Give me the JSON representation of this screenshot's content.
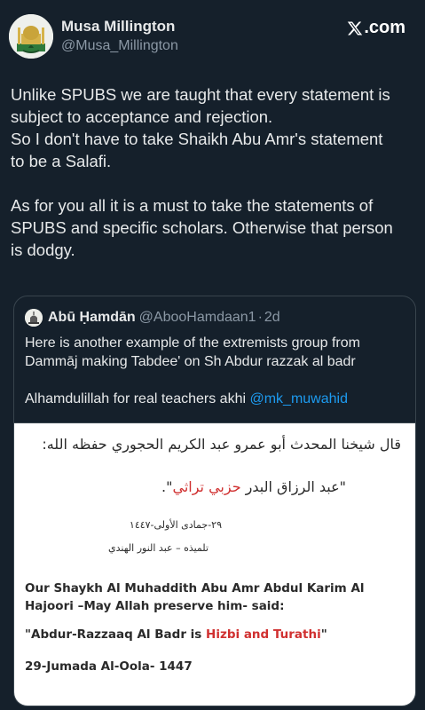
{
  "author": {
    "name": "Musa Millington",
    "handle": "@Musa_Millington"
  },
  "brand": {
    "label": ".com",
    "icon": "x-logo-icon"
  },
  "tweet": {
    "para1_line1": "Unlike SPUBS we are taught that every statement is",
    "para1_line2": "subject to acceptance and rejection.",
    "para1_line3": "So I don't have to take Shaikh Abu Amr's statement",
    "para1_line4": "to be a Salafi.",
    "para2_line1": "As for you all it is a must to take the statements of",
    "para2_line2": "SPUBS and specific scholars. Otherwise that person",
    "para2_line3": "is dodgy."
  },
  "quote": {
    "name": "Abū Ḥamdān",
    "handle": "@AbooHamdaan1",
    "separator": "·",
    "time": "2d",
    "line1": "Here is another example of the extremists group from",
    "line2": "Dammāj making Tabdee' on Sh Abdur razzak al badr",
    "line3": "Alhamdulillah for real teachers akhi ",
    "mention": "@mk_muwahid"
  },
  "image": {
    "ar_line1": "قال شيخنا المحدث أبو عمرو عبد الكريم الحجوري حفظه الله:",
    "ar_line2_a": "\"عبد الرزاق البدر ",
    "ar_line2_b": "حزبي تراثي",
    "ar_line2_c": "\".",
    "ar_line3": "٢٩-جمادى الأولى-١٤٤٧",
    "ar_line4": "تلميذه – عبد النور الهندي",
    "en_line1": "Our Shaykh Al Muhaddith Abu Amr Abdul Karim Al",
    "en_line2": "Hajoori –May Allah preserve him- said:",
    "en_line3_a": "\"Abdur-Razzaaq Al Badr is ",
    "en_line3_b": "Hizbi and Turathi",
    "en_line3_c": "\"",
    "en_line4": "29-Jumada Al-Oola- 1447"
  },
  "colors": {
    "background": "#15202b",
    "text": "#e7e9ea",
    "secondary": "#8b98a5",
    "link": "#1d9bf0",
    "border": "#38444d",
    "highlight_red": "#d03030"
  }
}
